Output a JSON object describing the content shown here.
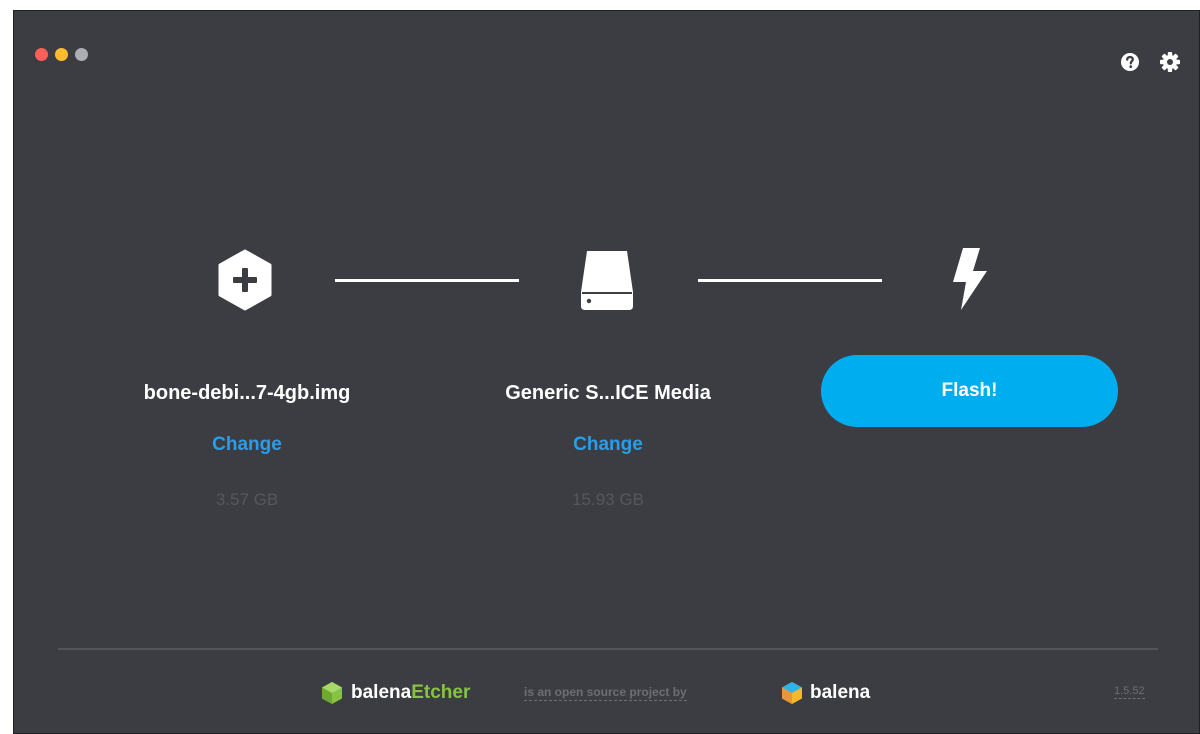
{
  "window": {
    "controls": [
      "close",
      "minimize",
      "maximize"
    ],
    "top_icons": [
      "help-icon",
      "gear-icon"
    ]
  },
  "steps": {
    "image": {
      "icon": "hexagon-plus-icon",
      "title": "bone-debi...7-4gb.img",
      "change_label": "Change",
      "size": "3.57 GB"
    },
    "drive": {
      "icon": "drive-icon",
      "title": "Generic S...ICE Media",
      "change_label": "Change",
      "size": "15.93 GB"
    },
    "flash": {
      "icon": "lightning-icon",
      "button_label": "Flash!"
    }
  },
  "footer": {
    "brand_prefix": "balena",
    "brand_suffix": "Etcher",
    "tagline": "is an open source project by",
    "company": "balena",
    "version": "1.5.52"
  },
  "colors": {
    "background": "#3c3d43",
    "accent": "#00aeef",
    "link": "#2a9de8",
    "etcher_green": "#85c341"
  }
}
